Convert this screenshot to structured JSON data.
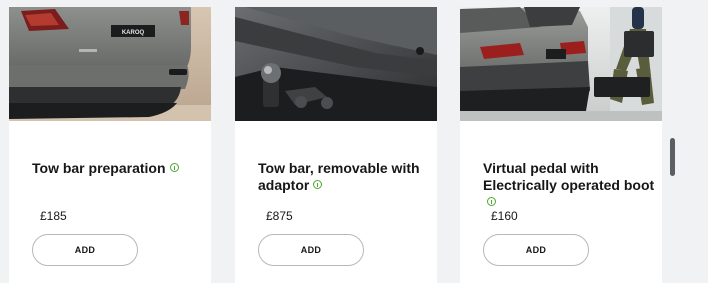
{
  "products": [
    {
      "title": "Tow bar preparation",
      "price": "£185",
      "add_label": "ADD",
      "info_icon": "info-icon",
      "image_badge": "KAROQ",
      "image_subject": "rear of grey SUV"
    },
    {
      "title": "Tow bar, removable with adaptor",
      "price": "£875",
      "add_label": "ADD",
      "info_icon": "info-icon",
      "image_subject": "tow bar ball close-up"
    },
    {
      "title": "Virtual pedal with Electrically operated boot",
      "price": "£160",
      "add_label": "ADD",
      "info_icon": "info-icon",
      "image_subject": "person loading boot of grey SUV"
    }
  ],
  "colors": {
    "page_background": "#f1f2f3",
    "card_background": "#ffffff",
    "text": "#161718",
    "info_accent": "#4ba82e",
    "button_border": "#b6b8bb",
    "scrollbar": "#5c5e61"
  }
}
